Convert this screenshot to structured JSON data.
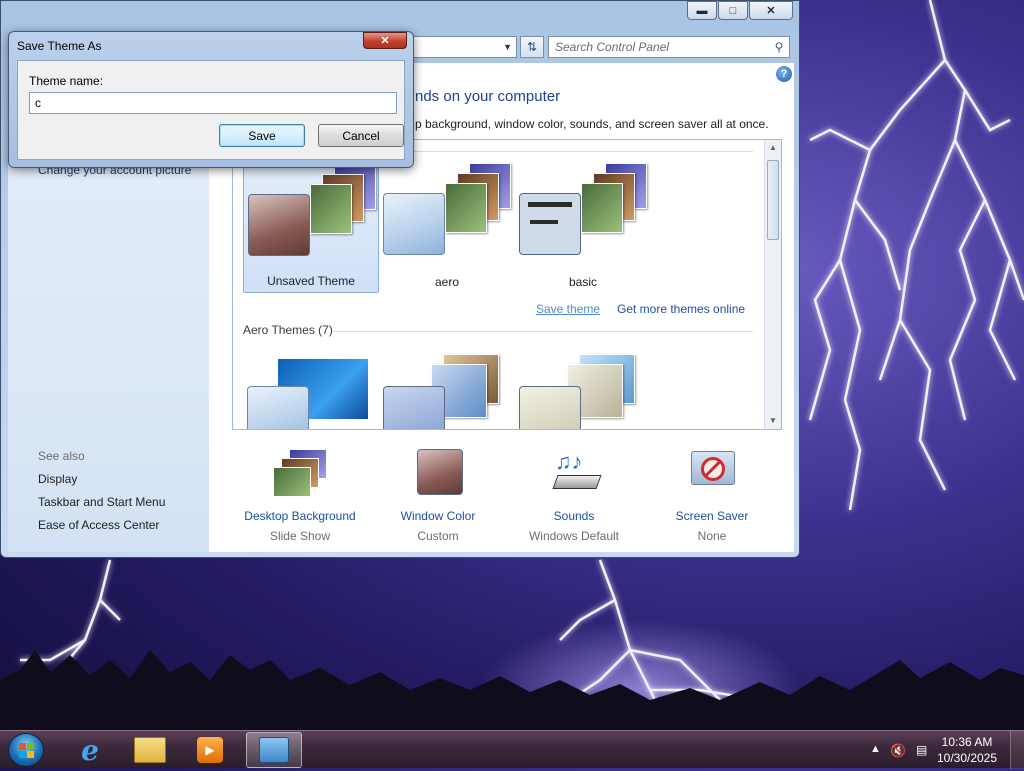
{
  "window": {
    "search_placeholder": "Search Control Panel",
    "heading_partial": "nds on your computer",
    "subtext_partial": "p background, window color, sounds, and screen saver all at once.",
    "left_link_cut": "Change your account picture"
  },
  "see_also": {
    "title": "See also",
    "links": [
      "Display",
      "Taskbar and Start Menu",
      "Ease of Access Center"
    ]
  },
  "my_themes": {
    "items": [
      {
        "label": "Unsaved Theme",
        "selected": true
      },
      {
        "label": "aero",
        "selected": false
      },
      {
        "label": "basic",
        "selected": false
      }
    ],
    "save_theme": "Save theme",
    "get_more": "Get more themes online"
  },
  "aero_themes": {
    "title": "Aero Themes (7)"
  },
  "bottom_tiles": [
    {
      "title": "Desktop Background",
      "sub": "Slide Show",
      "icon": "desktop-background-icon"
    },
    {
      "title": "Window Color",
      "sub": "Custom",
      "icon": "window-color-icon"
    },
    {
      "title": "Sounds",
      "sub": "Windows Default",
      "icon": "sounds-icon"
    },
    {
      "title": "Screen Saver",
      "sub": "None",
      "icon": "screen-saver-icon"
    }
  ],
  "dialog": {
    "title": "Save Theme As",
    "label": "Theme name:",
    "value": "c",
    "save": "Save",
    "cancel": "Cancel"
  },
  "taskbar": {
    "time": "10:36 AM",
    "date": "10/30/2025"
  },
  "colors": {
    "link": "#1e4fa5",
    "accent": "#1e3f9a",
    "close_red": "#c0412d"
  }
}
